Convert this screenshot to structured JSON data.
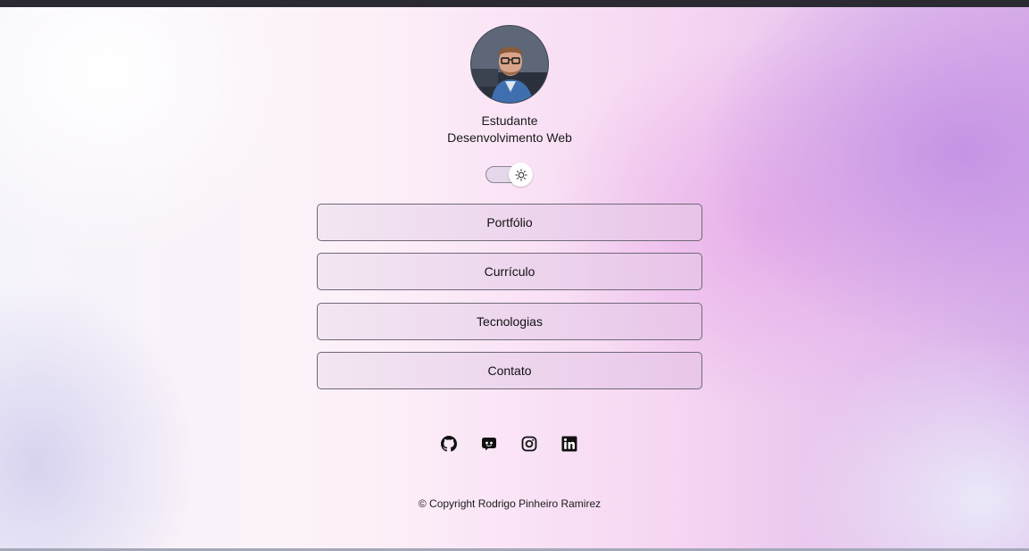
{
  "profile": {
    "role_line1": "Estudante",
    "role_line2": "Desenvolvimento Web"
  },
  "theme_toggle": {
    "mode": "light",
    "icon": "sun-icon"
  },
  "nav": {
    "items": [
      {
        "label": "Portfólio"
      },
      {
        "label": "Currículo"
      },
      {
        "label": "Tecnologias"
      },
      {
        "label": "Contato"
      }
    ]
  },
  "socials": [
    {
      "icon": "github-icon"
    },
    {
      "icon": "discord-icon"
    },
    {
      "icon": "instagram-icon"
    },
    {
      "icon": "linkedin-icon"
    }
  ],
  "footer": {
    "copyright": "© Copyright Rodrigo Pinheiro Ramirez"
  },
  "colors": {
    "accent_purple": "#c492e4",
    "button_border": "#6f6878",
    "text": "#1a1a1a"
  }
}
